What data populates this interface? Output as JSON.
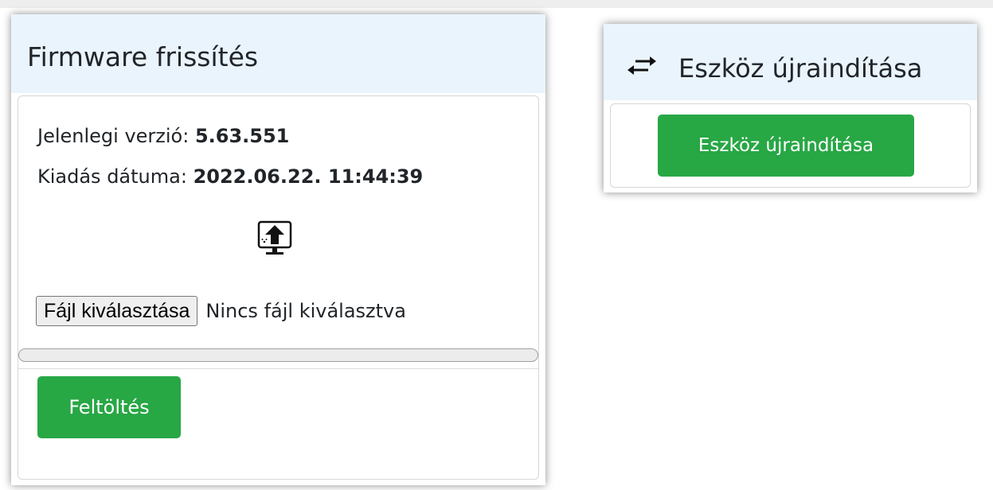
{
  "firmware_card": {
    "title": "Firmware frissítés",
    "current_version_label": "Jelenlegi verzió: ",
    "current_version": "5.63.551",
    "release_date_label": "Kiadás dátuma: ",
    "release_date": "2022.06.22. 11:44:39",
    "upload_icon": "monitor-upload-icon",
    "file_button_label": "Fájl kiválasztása",
    "file_status": "Nincs fájl kiválasztva",
    "progress_percent": 0,
    "upload_button_label": "Feltöltés"
  },
  "restart_card": {
    "icon": "swap-arrows-icon",
    "title": "Eszköz újraindítása",
    "button_label": "Eszköz újraindítása"
  },
  "colors": {
    "header_bg": "#eaf4fd",
    "button_green": "#28a745"
  }
}
